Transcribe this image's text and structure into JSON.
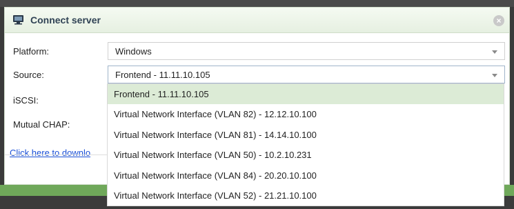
{
  "dialog": {
    "title": "Connect server",
    "close_symbol": "×",
    "icons": {
      "title": "server-icon",
      "close": "close-icon"
    },
    "colors": {
      "selected_option": "#dcebd6",
      "link": "#1a4fd6",
      "title_text": "#2f4254"
    }
  },
  "form": {
    "platform_label": "Platform:",
    "platform_value": "Windows",
    "source_label": "Source:",
    "source_value": "Frontend - 11.11.10.105",
    "iscsi_label": "iSCSI:",
    "chap_label": "Mutual CHAP:",
    "download_link": "Click here to downlo"
  },
  "dropdown": {
    "options": [
      "Frontend - 11.11.10.105",
      "Virtual Network Interface (VLAN 82) - 12.12.10.100",
      "Virtual Network Interface (VLAN 81) - 14.14.10.100",
      "Virtual Network Interface (VLAN 50) - 10.2.10.231",
      "Virtual Network Interface (VLAN 84) - 20.20.10.100",
      "Virtual Network Interface (VLAN 52) - 21.21.10.100"
    ],
    "selected_index": 0
  }
}
